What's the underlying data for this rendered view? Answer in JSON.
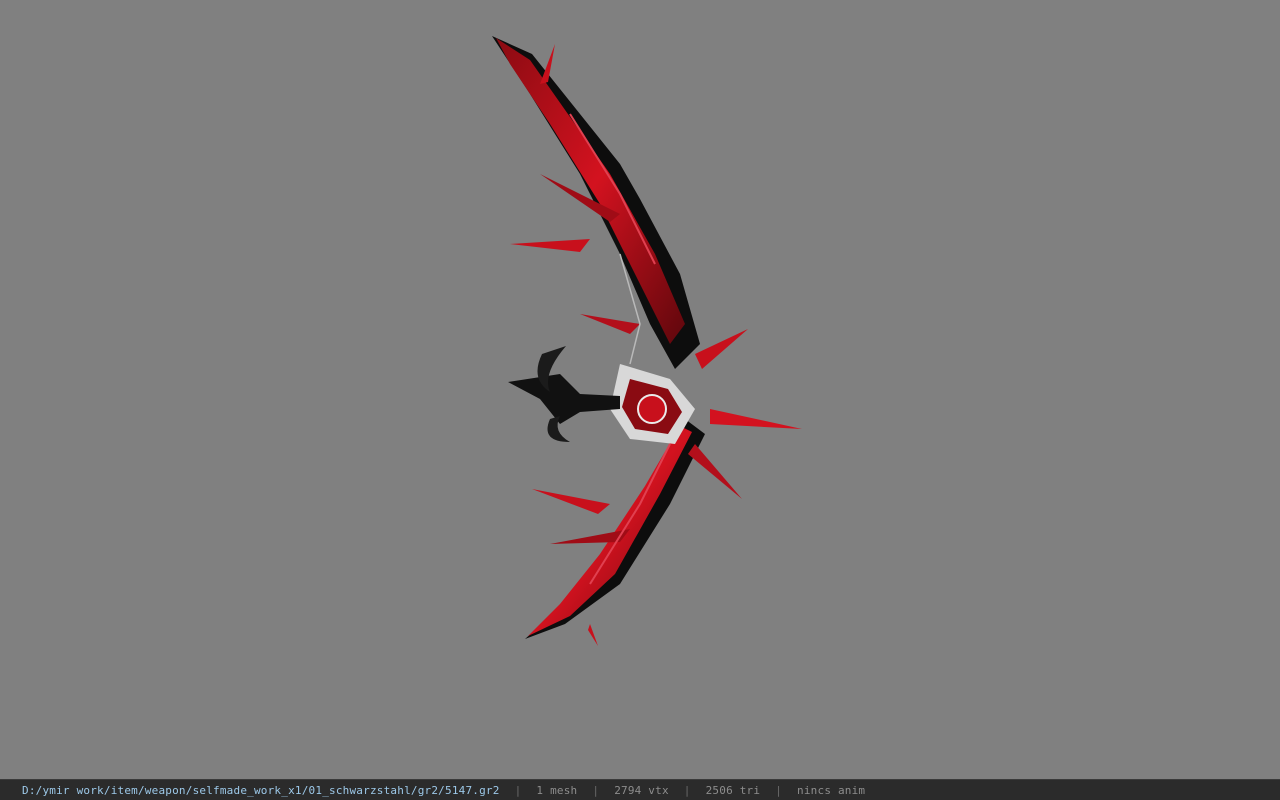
{
  "viewport": {
    "background": "#808080",
    "model": {
      "name": "red-black-bow-model",
      "colors": {
        "primary": "#c8101c",
        "dark": "#0a0a0a",
        "metal": "#c9c9c9"
      }
    }
  },
  "statusbar": {
    "path": "D:/ymir work/item/weapon/selfmade_work_x1/01_schwarzstahl/gr2/5147.gr2",
    "separator": "|",
    "mesh_count": "1 mesh",
    "vertex_count": "2794 vtx",
    "triangle_count": "2506 tri",
    "animation": "nincs anim"
  }
}
